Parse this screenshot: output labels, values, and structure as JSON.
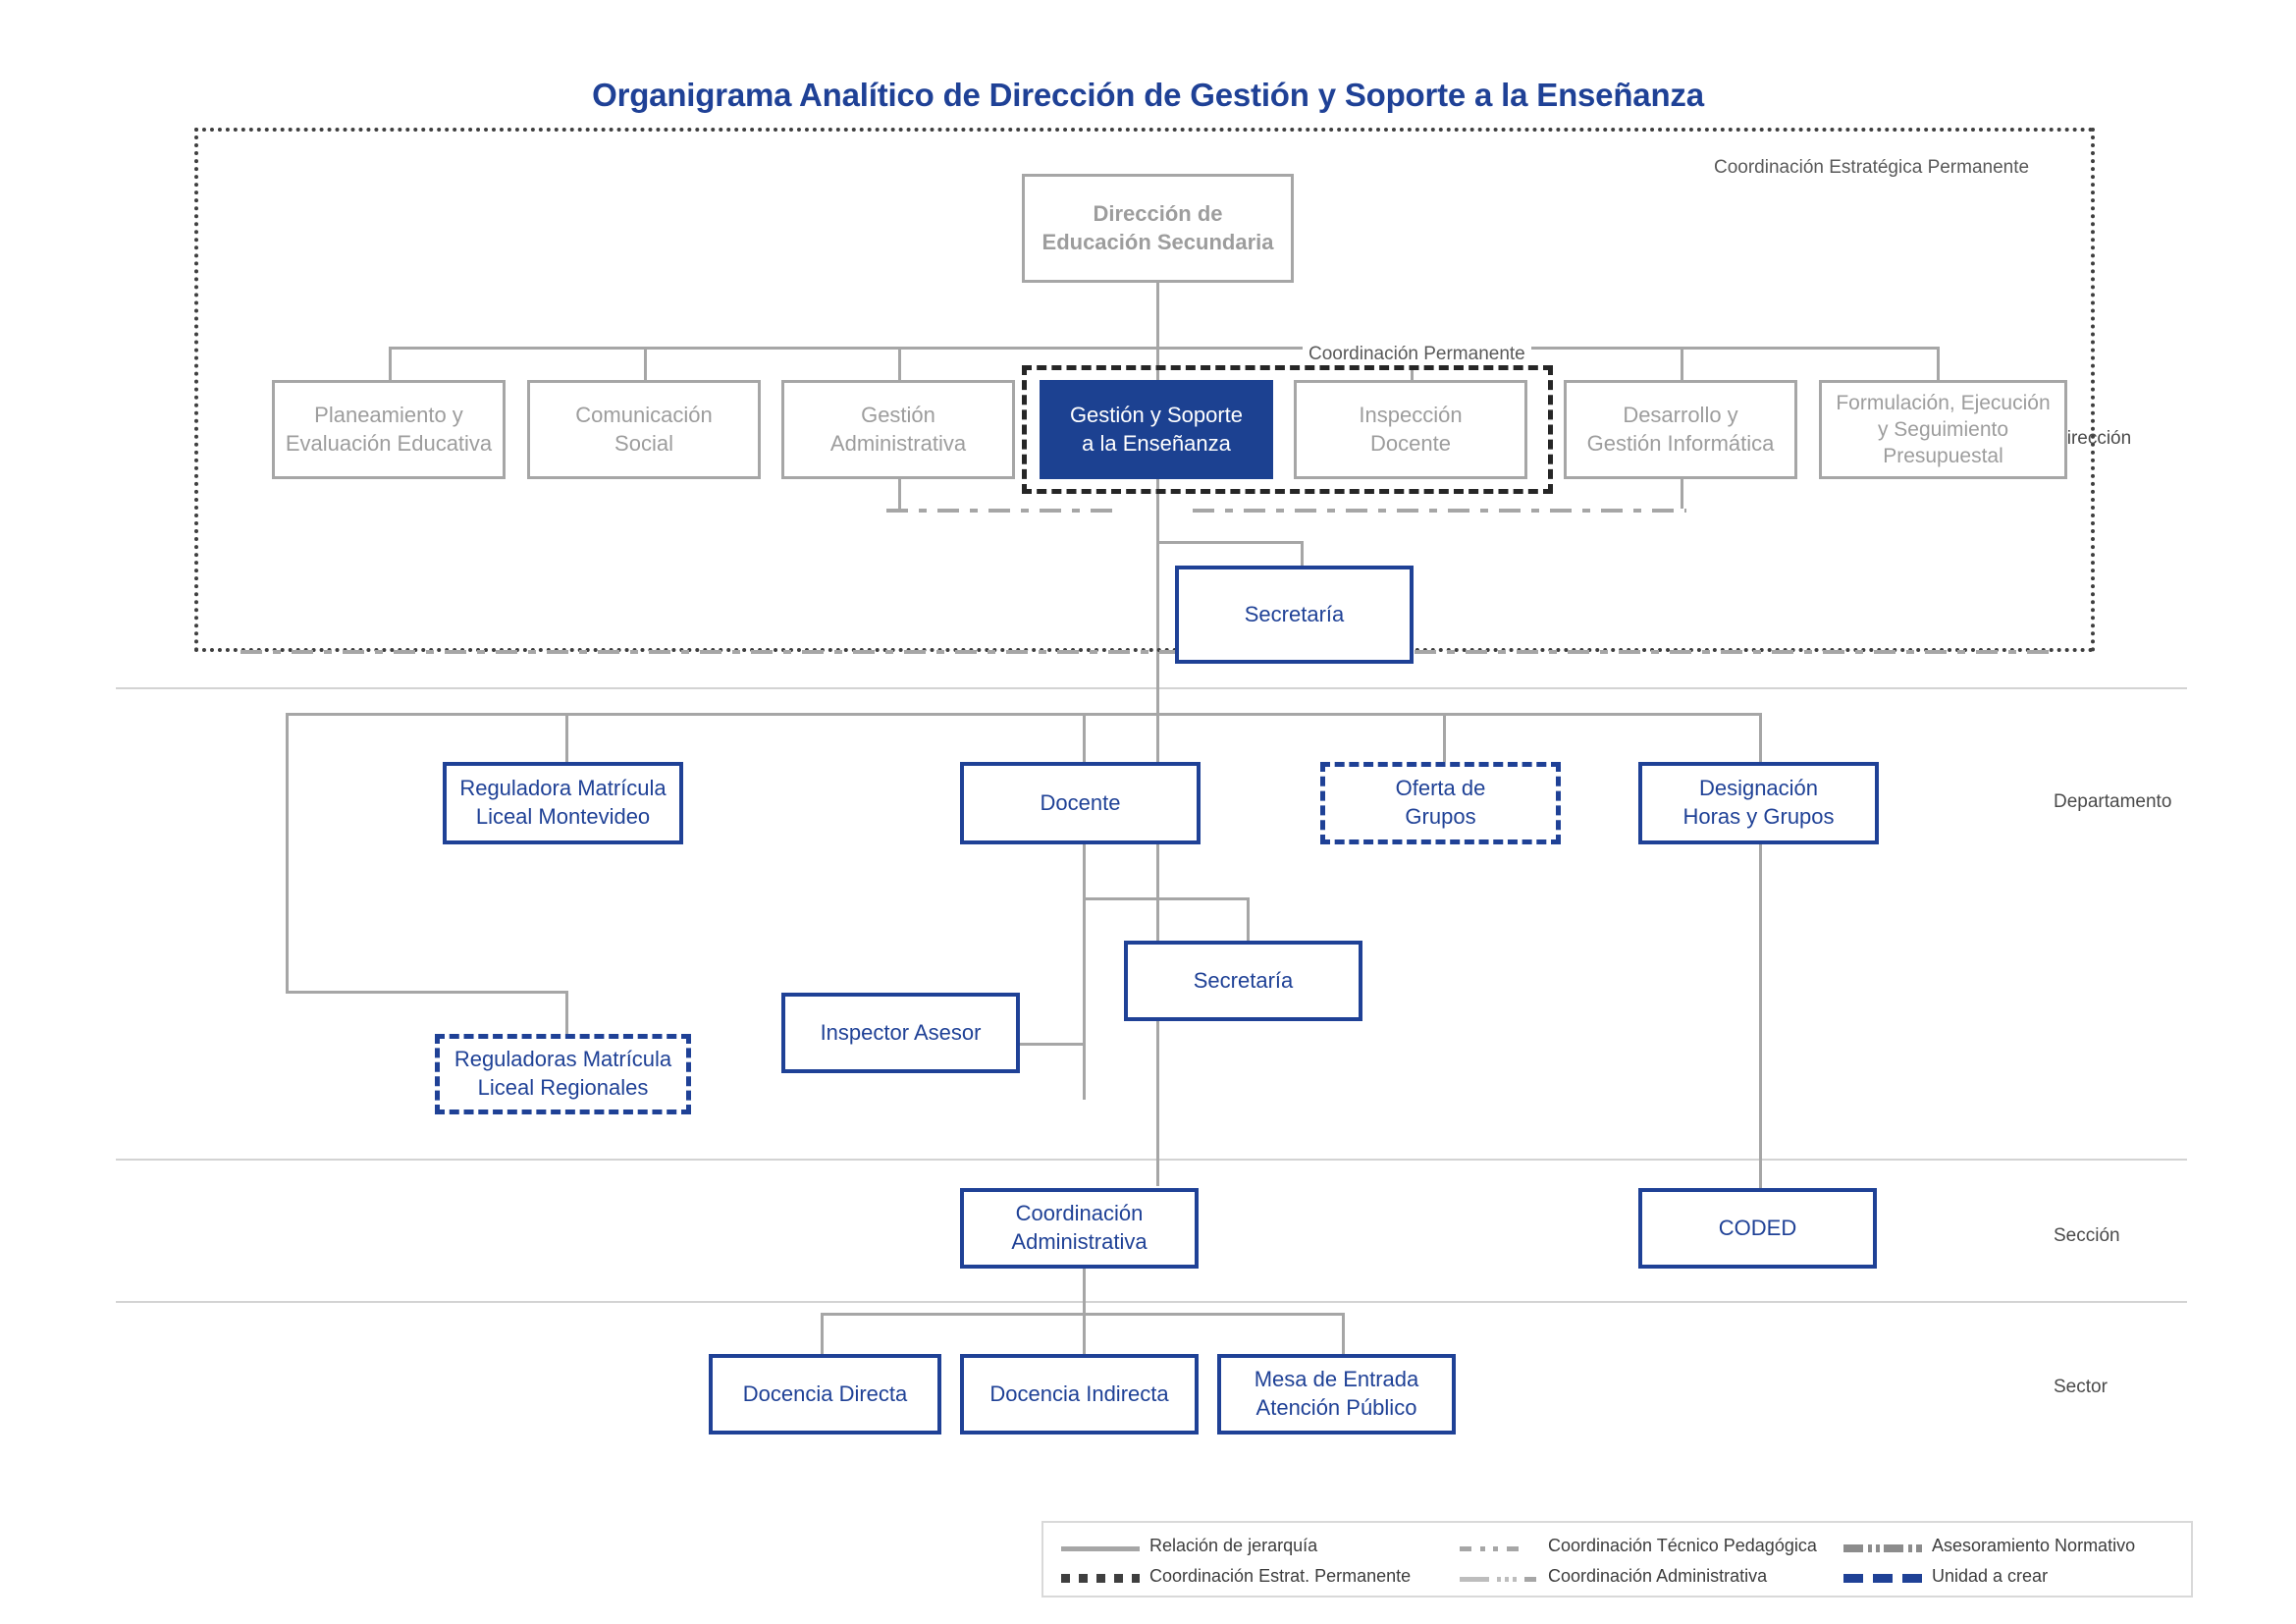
{
  "title": "Organigrama Analítico de Dirección de Gestión y Soporte a la Enseñanza",
  "colors": {
    "accent_blue": "#1f4196",
    "filled_blue": "#1c4191",
    "gray_line": "#a6a6a6",
    "gray_text": "#9d9d9d",
    "frame_dark": "#3f3f3f"
  },
  "frames": {
    "strategic_label": "Coordinación Estratégica Permanente",
    "permanent_label": "Coordinación Permanente"
  },
  "bands": [
    {
      "label": "Dirección"
    },
    {
      "label": "Departamento"
    },
    {
      "label": "Sección"
    },
    {
      "label": "Sector"
    }
  ],
  "nodes": {
    "root": {
      "line1": "Dirección de",
      "line2": "Educación Secundaria"
    },
    "direccion_row": [
      {
        "line1": "Planeamiento y",
        "line2": "Evaluación Educativa"
      },
      {
        "line1": "Comunicación",
        "line2": "Social"
      },
      {
        "line1": "Gestión",
        "line2": "Administrativa"
      },
      {
        "line1": "Gestión y Soporte",
        "line2": "a la Enseñanza"
      },
      {
        "line1": "Inspección",
        "line2": "Docente"
      },
      {
        "line1": "Desarrollo y",
        "line2": "Gestión Informática"
      },
      {
        "line1": "Formulación, Ejecución",
        "line2": "y Seguimiento",
        "line3": "Presupuestal"
      }
    ],
    "secretaria_direccion": {
      "line1": "Secretaría"
    },
    "departamento_row": [
      {
        "line1": "Reguladora Matrícula",
        "line2": "Liceal Montevideo"
      },
      {
        "line1": "Docente"
      },
      {
        "line1": "Oferta de",
        "line2": "Grupos"
      },
      {
        "line1": "Designación",
        "line2": "Horas y Grupos"
      }
    ],
    "reguladoras_regionales": {
      "line1": "Reguladoras Matrícula",
      "line2": "Liceal Regionales"
    },
    "inspector_asesor": {
      "line1": "Inspector Asesor"
    },
    "secretaria_docente": {
      "line1": "Secretaría"
    },
    "seccion_row": [
      {
        "line1": "Coordinación",
        "line2": "Administrativa"
      },
      {
        "line1": "CODED"
      }
    ],
    "sector_row": [
      {
        "line1": "Docencia Directa"
      },
      {
        "line1": "Docencia Indirecta"
      },
      {
        "line1": "Mesa de Entrada",
        "line2": "Atención Público"
      }
    ]
  },
  "legend": {
    "items": [
      {
        "label": "Relación de jerarquía",
        "style": "solid"
      },
      {
        "label": "Coordinación Estrat. Permanente",
        "style": "square-dotted"
      },
      {
        "label": "Coordinación Técnico Pedagógica",
        "style": "dash-dot-small"
      },
      {
        "label": "Coordinación Administrativa",
        "style": "line-dots"
      },
      {
        "label": "Asesoramiento Normativo",
        "style": "dash-dot-dot"
      },
      {
        "label": "Unidad a crear",
        "style": "blue-dashed"
      }
    ]
  }
}
